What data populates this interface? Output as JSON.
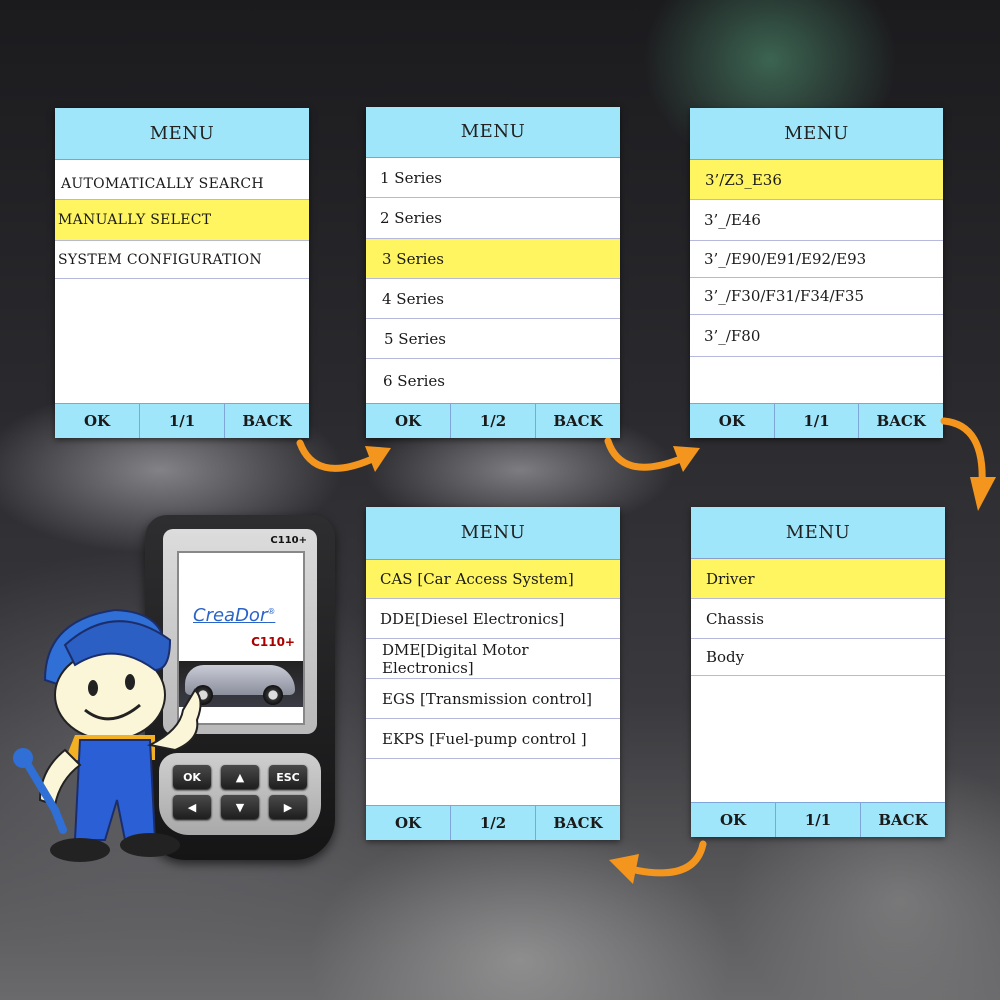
{
  "colors": {
    "header_bg": "#a0e6fb",
    "selected_bg": "#fef560",
    "row_divider": "#b6b8de",
    "arrow": "#f4961e"
  },
  "panels": [
    {
      "title": "MENU",
      "items": [
        {
          "label": "AUTOMATICALLY  SEARCH",
          "selected": false
        },
        {
          "label": "MANUALLY  SELECT",
          "selected": true
        },
        {
          "label": "SYSTEM  CONFIGURATION",
          "selected": false
        }
      ],
      "footer": {
        "ok": "OK",
        "page": "1/1",
        "back": "BACK"
      }
    },
    {
      "title": "MENU",
      "items": [
        {
          "label": "1 Series",
          "selected": false
        },
        {
          "label": "2 Series",
          "selected": false
        },
        {
          "label": "3 Series",
          "selected": true
        },
        {
          "label": "4 Series",
          "selected": false
        },
        {
          "label": "5 Series",
          "selected": false
        },
        {
          "label": "6 Series",
          "selected": false
        }
      ],
      "footer": {
        "ok": "OK",
        "page": "1/2",
        "back": "BACK"
      }
    },
    {
      "title": "MENU",
      "items": [
        {
          "label": "3’/Z3_E36",
          "selected": true
        },
        {
          "label": "3’_/E46",
          "selected": false
        },
        {
          "label": "3’_/E90/E91/E92/E93",
          "selected": false
        },
        {
          "label": "3’_/F30/F31/F34/F35",
          "selected": false
        },
        {
          "label": "3’_/F80",
          "selected": false
        }
      ],
      "footer": {
        "ok": "OK",
        "page": "1/1",
        "back": "BACK"
      }
    },
    {
      "title": "MENU",
      "items": [
        {
          "label": "CAS [Car Access System]",
          "selected": true
        },
        {
          "label": "DDE[Diesel Electronics]",
          "selected": false
        },
        {
          "label": "DME[Digital Motor Electronics]",
          "selected": false
        },
        {
          "label": "EGS [Transmission control]",
          "selected": false
        },
        {
          "label": "EKPS [Fuel-pump control ]",
          "selected": false
        }
      ],
      "footer": {
        "ok": "OK",
        "page": "1/2",
        "back": "BACK"
      }
    },
    {
      "title": "MENU",
      "items": [
        {
          "label": "Driver",
          "selected": true
        },
        {
          "label": "Chassis",
          "selected": false
        },
        {
          "label": "Body",
          "selected": false
        }
      ],
      "footer": {
        "ok": "OK",
        "page": "1/1",
        "back": "BACK"
      }
    }
  ],
  "device": {
    "model": "C110+",
    "brand": "CreaDor",
    "brand_mark": "®",
    "screen_model": "C110+",
    "keys": {
      "ok": "OK",
      "up": "▲",
      "esc": "ESC",
      "left": "◀",
      "down": "▼",
      "right": "▶"
    }
  }
}
